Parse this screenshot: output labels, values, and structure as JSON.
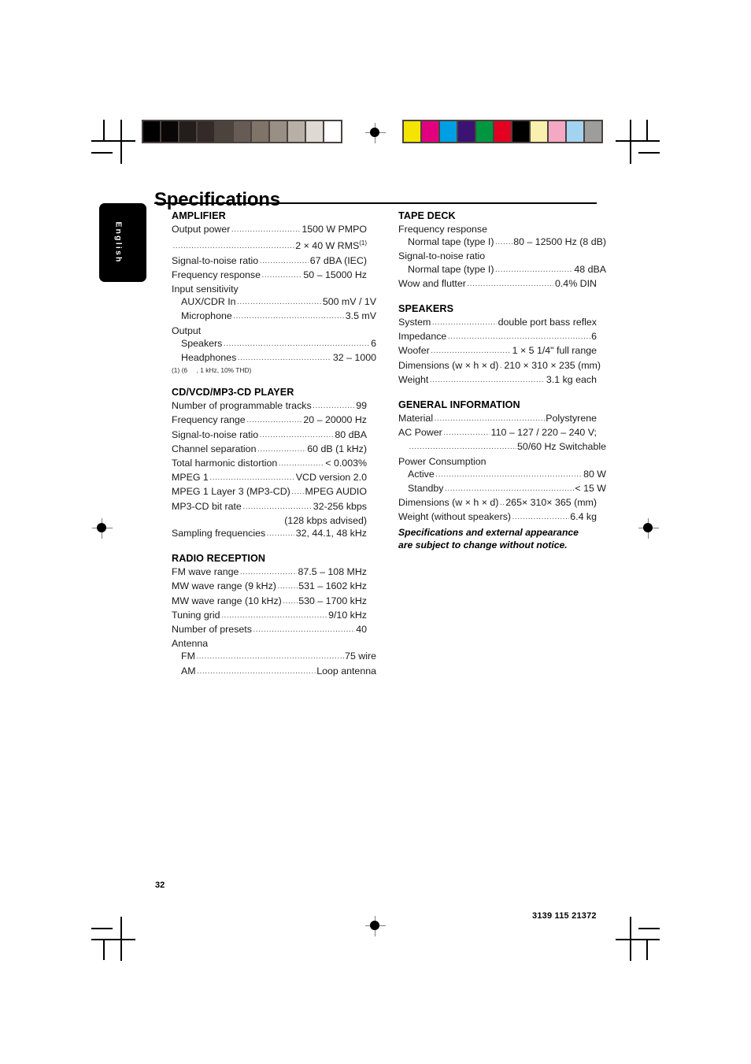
{
  "document": {
    "title": "Specifications",
    "language_tab": "English",
    "page_number": "32",
    "part_number": "3139 115 21372",
    "notice": "Specifications and external appearance are subject to change without notice."
  },
  "sections": {
    "amplifier": {
      "heading": "AMPLIFIER",
      "rows": [
        {
          "label": "Output power",
          "value": "1500 W PMPO",
          "leader": true
        },
        {
          "label": "",
          "value": "2 × 40 W RMS",
          "sup": "(1)",
          "leader": true
        },
        {
          "label": "Signal-to-noise ratio",
          "value": "67 dBA (IEC)",
          "leader": true
        },
        {
          "label": "Frequency response",
          "value": "50 – 15000 Hz",
          "leader": true
        },
        {
          "label": "Input sensitivity",
          "value": "",
          "leader": false
        },
        {
          "label": "AUX/CDR In",
          "value": "500 mV / 1V",
          "leader": true,
          "indent": true
        },
        {
          "label": "Microphone",
          "value": "3.5 mV",
          "leader": true,
          "indent": true
        },
        {
          "label": "Output",
          "value": "",
          "leader": false
        },
        {
          "label": "Speakers",
          "value": "6",
          "leader": true,
          "indent": true
        },
        {
          "label": "Headphones",
          "value": "32      – 1000",
          "leader": true,
          "indent": true
        }
      ],
      "footnote": "(1) (6     , 1 kHz, 10% THD)"
    },
    "cd_player": {
      "heading": "CD/VCD/MP3-CD PLAYER",
      "rows": [
        {
          "label": "Number of programmable tracks",
          "value": "99",
          "leader": true
        },
        {
          "label": "Frequency range",
          "value": "20 – 20000 Hz",
          "leader": true
        },
        {
          "label": "Signal-to-noise ratio",
          "value": "80 dBA",
          "leader": true
        },
        {
          "label": "Channel separation",
          "value": "60 dB (1 kHz)",
          "leader": true
        },
        {
          "label": "Total harmonic distortion",
          "value": "< 0.003%",
          "leader": true
        },
        {
          "label": "MPEG 1",
          "value": "VCD version 2.0",
          "leader": true
        },
        {
          "label": "MPEG 1 Layer 3 (MP3-CD)",
          "value": "MPEG AUDIO",
          "leader": true
        },
        {
          "label": "MP3-CD bit rate",
          "value": "32-256 kbps",
          "leader": true
        },
        {
          "label": "",
          "value": "(128 kbps advised)",
          "leader": false,
          "align": "right"
        },
        {
          "label": "Sampling frequencies",
          "value": "32, 44.1, 48 kHz",
          "leader": true
        }
      ]
    },
    "radio": {
      "heading": "RADIO RECEPTION",
      "rows": [
        {
          "label": "FM wave range",
          "value": "87.5 – 108 MHz",
          "leader": true
        },
        {
          "label": "MW wave range (9 kHz)",
          "value": "531 – 1602 kHz",
          "leader": true
        },
        {
          "label": "MW wave range (10 kHz)",
          "value": "530 – 1700 kHz",
          "leader": true
        },
        {
          "label": "Tuning grid",
          "value": "9/10 kHz",
          "leader": true
        },
        {
          "label": "Number of presets",
          "value": "40",
          "leader": true
        },
        {
          "label": "Antenna",
          "value": "",
          "leader": false
        },
        {
          "label": "FM",
          "value": "75       wire",
          "leader": true,
          "indent": true
        },
        {
          "label": "AM",
          "value": "Loop antenna",
          "leader": true,
          "indent": true
        }
      ]
    },
    "tape_deck": {
      "heading": "TAPE DECK",
      "rows": [
        {
          "label": "Frequency response",
          "value": "",
          "leader": false
        },
        {
          "label": "Normal tape (type I)",
          "value": "80 – 12500 Hz (8 dB)",
          "leader": true,
          "indent": true
        },
        {
          "label": "Signal-to-noise ratio",
          "value": "",
          "leader": false
        },
        {
          "label": "Normal tape (type I)",
          "value": "48 dBA",
          "leader": true,
          "indent": true
        },
        {
          "label": "Wow and flutter",
          "value": "0.4% DIN",
          "leader": true
        }
      ]
    },
    "speakers": {
      "heading": "SPEAKERS",
      "rows": [
        {
          "label": "System",
          "value": "double port bass reflex",
          "leader": true
        },
        {
          "label": "Impedance",
          "value": "6",
          "leader": true
        },
        {
          "label": "Woofer",
          "value": "1 × 5 1/4\" full range",
          "leader": true
        },
        {
          "label": "Dimensions (w × h × d)",
          "value": "210 × 310 × 235 (mm)",
          "leader": true
        },
        {
          "label": "Weight",
          "value": "3.1 kg each",
          "leader": true
        }
      ]
    },
    "general": {
      "heading": "GENERAL INFORMATION",
      "rows": [
        {
          "label": "Material",
          "value": "Polystyrene",
          "leader": true
        },
        {
          "label": "AC Power",
          "value": "110 – 127 / 220 – 240 V;",
          "leader": true
        },
        {
          "label": "",
          "value": "50/60 Hz Switchable",
          "leader": true,
          "indent": true
        },
        {
          "label": "Power Consumption",
          "value": "",
          "leader": false
        },
        {
          "label": "Active",
          "value": "80 W",
          "leader": true,
          "indent": true
        },
        {
          "label": "Standby",
          "value": "< 15 W",
          "leader": true,
          "indent": true
        },
        {
          "label": "Dimensions (w × h × d)",
          "value": "265× 310× 365 (mm)",
          "leader": true
        },
        {
          "label": "Weight (without speakers)",
          "value": "6.4 kg",
          "leader": true
        }
      ]
    }
  },
  "print_marks": {
    "grayscale_strip": [
      "#000000",
      "#090607",
      "#231d1c",
      "#342b28",
      "#4c433d",
      "#665c55",
      "#807469",
      "#9a8f85",
      "#b8afa6",
      "#ded9d3",
      "#ffffff"
    ],
    "color_strip": [
      "#f5e400",
      "#e2007f",
      "#009fe3",
      "#3c1274",
      "#009640",
      "#e30020",
      "#000000",
      "#faf0ae",
      "#f5a8c3",
      "#a2d4f2",
      "#9d9d9c"
    ]
  }
}
